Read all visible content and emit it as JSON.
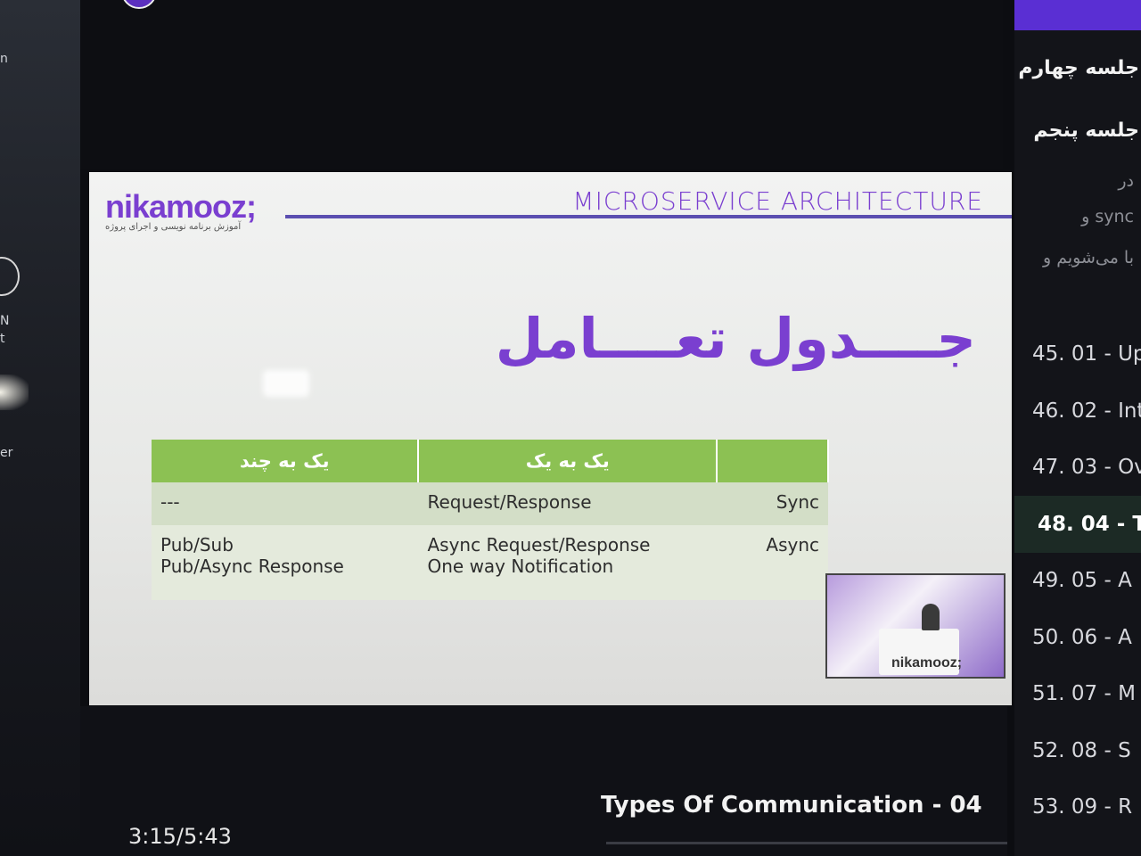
{
  "left_fragments": [
    "n",
    "N",
    "t",
    "er"
  ],
  "slide": {
    "logo": "nikamooz;",
    "logo_sub": "آموزش برنامه نویسی و اجرای پروژه",
    "heading": "MICROSERVICE ARCHITECTURE",
    "title": "جــــدول تعــــامل",
    "table": {
      "headers": [
        "یک به چند",
        "یک به یک",
        ""
      ],
      "rows": [
        {
          "one_to_many": "---",
          "one_to_one": "Request/Response",
          "label": "Sync"
        },
        {
          "one_to_many": [
            "Pub/Sub",
            "Pub/Async Response"
          ],
          "one_to_one": [
            "Async Request/Response",
            "One way Notification"
          ],
          "label": "Async"
        }
      ]
    },
    "webcam_logo": "nikamooz;"
  },
  "player": {
    "lesson_title": "Types Of Communication - 04",
    "timecode": "3:15/5:43"
  },
  "playlist": {
    "sections": [
      "جلسه چهارم",
      "جلسه پنجم"
    ],
    "descriptions": [
      "در",
      "sync و",
      "با می‌شویم و"
    ],
    "items": [
      {
        "label": "45. 01 - Up",
        "active": false
      },
      {
        "label": "46. 02 - Int",
        "active": false
      },
      {
        "label": "47. 03 - Ov",
        "active": false
      },
      {
        "label": "48. 04 - T",
        "active": true
      },
      {
        "label": "49. 05 - A",
        "active": false
      },
      {
        "label": "50. 06 - A",
        "active": false
      },
      {
        "label": "51. 07 - M",
        "active": false
      },
      {
        "label": "52. 08 - S",
        "active": false
      },
      {
        "label": "53. 09 - R",
        "active": false
      }
    ]
  }
}
